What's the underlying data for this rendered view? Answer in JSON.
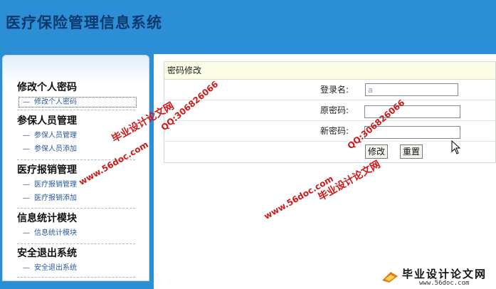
{
  "app": {
    "title": "医疗保险管理信息系统"
  },
  "sidebar": {
    "sections": [
      {
        "title": "修改个人密码",
        "items": [
          {
            "label": "修改个人密码",
            "active": true
          }
        ]
      },
      {
        "title": "参保人员管理",
        "items": [
          {
            "label": "参保人员管理"
          },
          {
            "label": "参保人员添加"
          }
        ]
      },
      {
        "title": "医疗报销管理",
        "items": [
          {
            "label": "医疗报销管理"
          },
          {
            "label": "医疗报销添加"
          }
        ]
      },
      {
        "title": "信息统计模块",
        "items": [
          {
            "label": "信息统计模块"
          }
        ]
      },
      {
        "title": "安全退出系统",
        "items": [
          {
            "label": "安全退出系统"
          }
        ]
      }
    ]
  },
  "form": {
    "heading": "密码修改",
    "login_label": "登录名:",
    "login_value": "a",
    "old_label": "原密码:",
    "new_label": "新密码:",
    "submit_label": "修改",
    "reset_label": "重置"
  },
  "watermark": {
    "site": "www.56doc.com",
    "qq": "QQ:306826066",
    "name": "毕业设计论文网",
    "footer_name": "毕业设计论文网",
    "footer_url": "www.56doc.com"
  },
  "colors": {
    "header_bg": "#2c8fd6",
    "title_text": "#0d3a6e",
    "form_head_bg": "#fbfde6",
    "watermark": "#d01818"
  }
}
